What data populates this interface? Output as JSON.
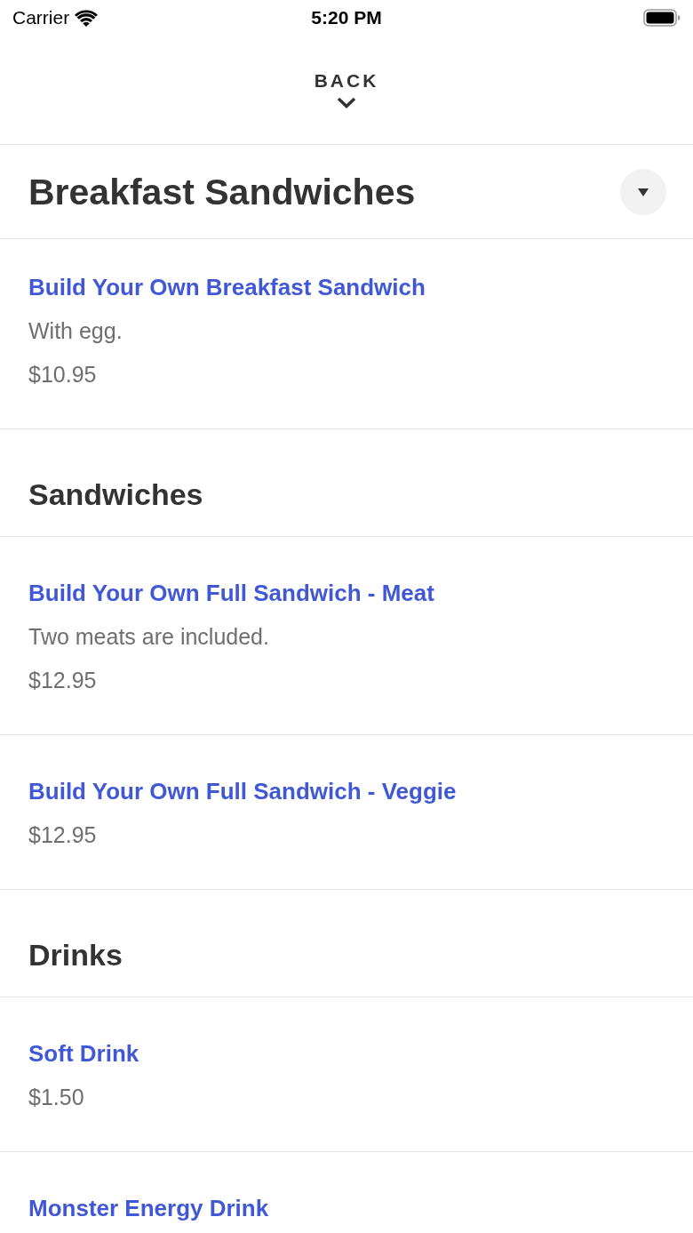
{
  "status_bar": {
    "carrier": "Carrier",
    "time": "5:20 PM"
  },
  "back_button": {
    "label": "BACK"
  },
  "sections": [
    {
      "title": "Breakfast Sandwiches",
      "kind": "collapsible",
      "items": [
        {
          "name": "Build Your Own Breakfast Sandwich",
          "description": "With egg.",
          "price": "$10.95"
        }
      ]
    },
    {
      "title": "Sandwiches",
      "kind": "plain",
      "items": [
        {
          "name": "Build Your Own Full Sandwich - Meat",
          "description": "Two meats are included.",
          "price": "$12.95"
        },
        {
          "name": "Build Your Own Full Sandwich - Veggie",
          "price": "$12.95"
        }
      ]
    },
    {
      "title": "Drinks",
      "kind": "plain",
      "items": [
        {
          "name": "Soft Drink",
          "price": "$1.50"
        },
        {
          "name": "Monster Energy Drink"
        }
      ]
    }
  ]
}
